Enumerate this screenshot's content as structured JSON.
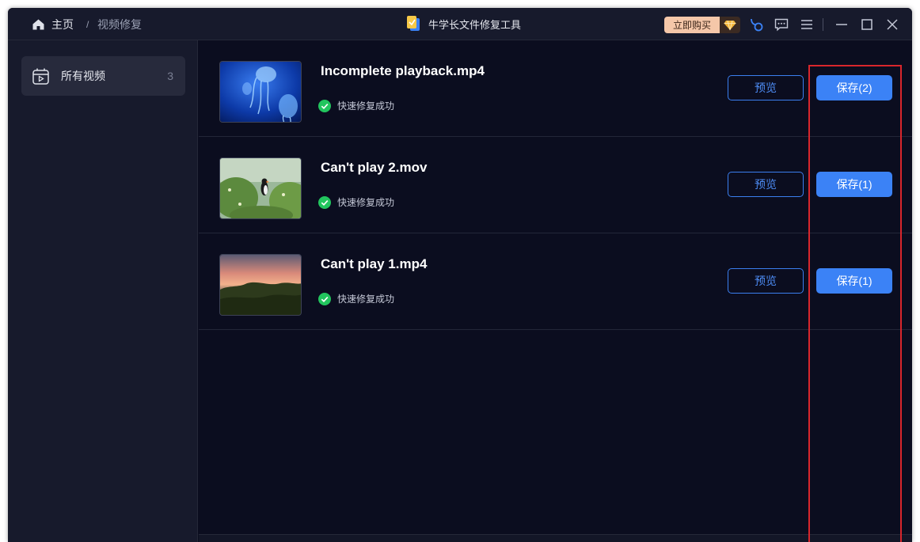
{
  "titlebar": {
    "breadcrumb_home": "主页",
    "breadcrumb_separator": "/",
    "breadcrumb_current": "视频修复",
    "app_title": "牛学长文件修复工具",
    "buy_label": "立即购买",
    "icons": [
      "home-icon",
      "app-logo-icon",
      "diamond-icon",
      "support-icon",
      "feedback-icon",
      "menu-icon",
      "minimize-icon",
      "maximize-icon",
      "close-icon"
    ]
  },
  "sidebar": {
    "items": [
      {
        "label": "所有视频",
        "count": "3",
        "icon": "video-library-icon"
      }
    ]
  },
  "files": [
    {
      "name": "Incomplete playback.mp4",
      "status": "快速修复成功",
      "preview_label": "预览",
      "save_label": "保存(2)",
      "thumbnail": "jellyfish"
    },
    {
      "name": "Can't play 2.mov",
      "status": "快速修复成功",
      "preview_label": "预览",
      "save_label": "保存(1)",
      "thumbnail": "puffin"
    },
    {
      "name": "Can't play 1.mp4",
      "status": "快速修复成功",
      "preview_label": "预览",
      "save_label": "保存(1)",
      "thumbnail": "sunset-forest"
    }
  ],
  "colors": {
    "accent": "#3b82f6",
    "success": "#22c55e",
    "highlight_box": "#d9262c",
    "background": "#0b0d1f"
  }
}
